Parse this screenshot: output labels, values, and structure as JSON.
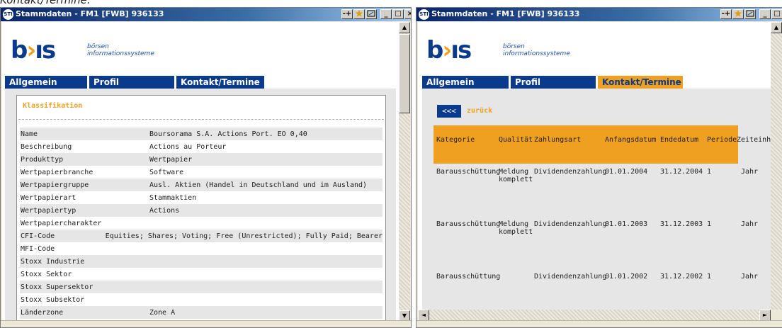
{
  "caption": "Kontakt/Termine.",
  "windows": [
    {
      "title": "Stammdaten - FM1 [FWB]  936133",
      "app_icon": "STI",
      "controls": {
        "restore": "-+",
        "minimize": "_",
        "maximize": "□",
        "close": "×"
      }
    },
    {
      "title": "Stammdaten - FM1 [FWB]  936133",
      "app_icon": "STI",
      "controls": {
        "restore": "-+",
        "minimize": "_",
        "maximize": "□",
        "close": "×"
      }
    }
  ],
  "logo": {
    "mark": "b",
    "mark_dot": "›",
    "mark_end": "ıs",
    "line1": "börsen",
    "line2": "informationssysteme"
  },
  "tabs": [
    "Allgemein",
    "Profil",
    "Kontakt/Termine"
  ],
  "scroll": {
    "up": "▲",
    "down": "▼",
    "left": "◄",
    "right": "►"
  },
  "left": {
    "section_title": "Klassifikation",
    "rows": [
      {
        "label": "Name",
        "value": "Boursorama S.A. Actions Port. EO 0,40"
      },
      {
        "label": "Beschreibung",
        "value": "Actions au Porteur"
      },
      {
        "label": "Produkttyp",
        "value": "Wertpapier"
      },
      {
        "label": "Wertpapierbranche",
        "value": "Software"
      },
      {
        "label": "Wertpapiergruppe",
        "value": "Ausl. Aktien (Handel in Deutschland und im Ausland)"
      },
      {
        "label": "Wertpapierart",
        "value": "Stammaktien"
      },
      {
        "label": "Wertpapiertyp",
        "value": "Actions"
      },
      {
        "label": "Wertpapiercharakter",
        "value": ""
      },
      {
        "label": "CFI-Code",
        "value": "Equities; Shares; Voting; Free (Unrestricted); Fully Paid; Bearer"
      },
      {
        "label": "MFI-Code",
        "value": ""
      },
      {
        "label": "Stoxx Industrie",
        "value": ""
      },
      {
        "label": "Stoxx Sektor",
        "value": ""
      },
      {
        "label": "Stoxx Supersektor",
        "value": ""
      },
      {
        "label": "Stoxx Subsektor",
        "value": ""
      },
      {
        "label": "Länderzone",
        "value": "Zone A"
      }
    ]
  },
  "right": {
    "back_button": "<<<",
    "back_label": "zurück",
    "columns": [
      "Kategorie",
      "Qualität",
      "Zahlungsart",
      "Anfangsdatum",
      "Endedatum",
      "Periode",
      "Zeiteinheit"
    ],
    "rows": [
      [
        "Barausschüttung",
        "Meldung\nkomplett",
        "Dividendenzahlung",
        "01.01.2004",
        "31.12.2004",
        "1",
        "Jahr"
      ],
      [
        "Barausschüttung",
        "Meldung\nkomplett",
        "Dividendenzahlung",
        "01.01.2003",
        "31.12.2003",
        "1",
        "Jahr"
      ],
      [
        "Barausschüttung",
        "",
        "Dividendenzahlung",
        "01.01.2002",
        "31.12.2002",
        "1",
        "Jahr"
      ]
    ]
  }
}
